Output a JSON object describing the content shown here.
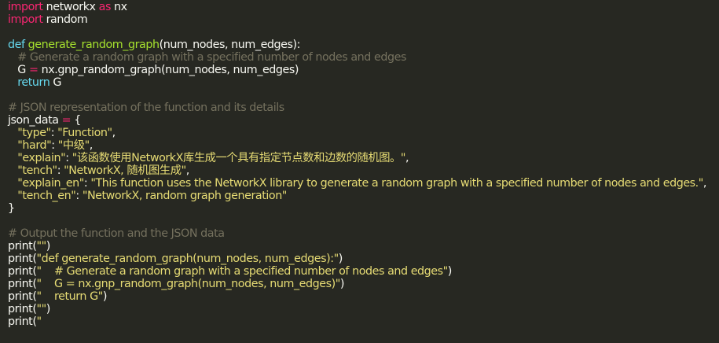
{
  "editor": {
    "lines": [
      [
        {
          "t": "import",
          "c": "kw"
        },
        {
          "t": " networkx ",
          "c": "plain"
        },
        {
          "t": "as",
          "c": "kw"
        },
        {
          "t": " nx",
          "c": "plain"
        }
      ],
      [
        {
          "t": "import",
          "c": "kw"
        },
        {
          "t": " random",
          "c": "plain"
        }
      ],
      [],
      [
        {
          "t": "def",
          "c": "def"
        },
        {
          "t": " ",
          "c": "plain"
        },
        {
          "t": "generate_random_graph",
          "c": "fn"
        },
        {
          "t": "(num_nodes, num_edges):",
          "c": "plain"
        }
      ],
      [
        {
          "t": "   # Generate a random graph with a specified number of nodes and edges",
          "c": "cmt"
        }
      ],
      [
        {
          "t": "   G ",
          "c": "plain"
        },
        {
          "t": "=",
          "c": "op"
        },
        {
          "t": " nx.gnp_random_graph(num_nodes, num_edges)",
          "c": "plain"
        }
      ],
      [
        {
          "t": "   ",
          "c": "plain"
        },
        {
          "t": "return",
          "c": "def"
        },
        {
          "t": " G",
          "c": "plain"
        }
      ],
      [],
      [
        {
          "t": "# JSON representation of the function and its details",
          "c": "cmt"
        }
      ],
      [
        {
          "t": "json_data ",
          "c": "plain"
        },
        {
          "t": "=",
          "c": "op"
        },
        {
          "t": " {",
          "c": "plain"
        }
      ],
      [
        {
          "t": "   ",
          "c": "plain"
        },
        {
          "t": "\"type\"",
          "c": "str"
        },
        {
          "t": ": ",
          "c": "plain"
        },
        {
          "t": "\"Function\"",
          "c": "str"
        },
        {
          "t": ",",
          "c": "plain"
        }
      ],
      [
        {
          "t": "   ",
          "c": "plain"
        },
        {
          "t": "\"hard\"",
          "c": "str"
        },
        {
          "t": ": ",
          "c": "plain"
        },
        {
          "t": "\"中级\"",
          "c": "str"
        },
        {
          "t": ",",
          "c": "plain"
        }
      ],
      [
        {
          "t": "   ",
          "c": "plain"
        },
        {
          "t": "\"explain\"",
          "c": "str"
        },
        {
          "t": ": ",
          "c": "plain"
        },
        {
          "t": "\"该函数使用NetworkX库生成一个具有指定节点数和边数的随机图。\"",
          "c": "str"
        },
        {
          "t": ",",
          "c": "plain"
        }
      ],
      [
        {
          "t": "   ",
          "c": "plain"
        },
        {
          "t": "\"tench\"",
          "c": "str"
        },
        {
          "t": ": ",
          "c": "plain"
        },
        {
          "t": "\"NetworkX, 随机图生成\"",
          "c": "str"
        },
        {
          "t": ",",
          "c": "plain"
        }
      ],
      [
        {
          "t": "   ",
          "c": "plain"
        },
        {
          "t": "\"explain_en\"",
          "c": "str"
        },
        {
          "t": ": ",
          "c": "plain"
        },
        {
          "t": "\"This function uses the NetworkX library to generate a random graph with a specified number of nodes and edges.\"",
          "c": "str"
        },
        {
          "t": ",",
          "c": "plain"
        }
      ],
      [
        {
          "t": "   ",
          "c": "plain"
        },
        {
          "t": "\"tench_en\"",
          "c": "str"
        },
        {
          "t": ": ",
          "c": "plain"
        },
        {
          "t": "\"NetworkX, random graph generation\"",
          "c": "str"
        }
      ],
      [
        {
          "t": "}",
          "c": "plain"
        }
      ],
      [],
      [
        {
          "t": "# Output the function and the JSON data",
          "c": "cmt"
        }
      ],
      [
        {
          "t": "print(",
          "c": "plain"
        },
        {
          "t": "\"\"",
          "c": "str"
        },
        {
          "t": ")",
          "c": "plain"
        }
      ],
      [
        {
          "t": "print(",
          "c": "plain"
        },
        {
          "t": "\"def generate_random_graph(num_nodes, num_edges):\"",
          "c": "str"
        },
        {
          "t": ")",
          "c": "plain"
        }
      ],
      [
        {
          "t": "print(",
          "c": "plain"
        },
        {
          "t": "\"    # Generate a random graph with a specified number of nodes and edges\"",
          "c": "str"
        },
        {
          "t": ")",
          "c": "plain"
        }
      ],
      [
        {
          "t": "print(",
          "c": "plain"
        },
        {
          "t": "\"    G = nx.gnp_random_graph(num_nodes, num_edges)\"",
          "c": "str"
        },
        {
          "t": ")",
          "c": "plain"
        }
      ],
      [
        {
          "t": "print(",
          "c": "plain"
        },
        {
          "t": "\"    return G\"",
          "c": "str"
        },
        {
          "t": ")",
          "c": "plain"
        }
      ],
      [
        {
          "t": "print(",
          "c": "plain"
        },
        {
          "t": "\"\"",
          "c": "str"
        },
        {
          "t": ")",
          "c": "plain"
        }
      ],
      [
        {
          "t": "print(",
          "c": "plain"
        },
        {
          "t": "\"",
          "c": "str"
        }
      ]
    ]
  }
}
